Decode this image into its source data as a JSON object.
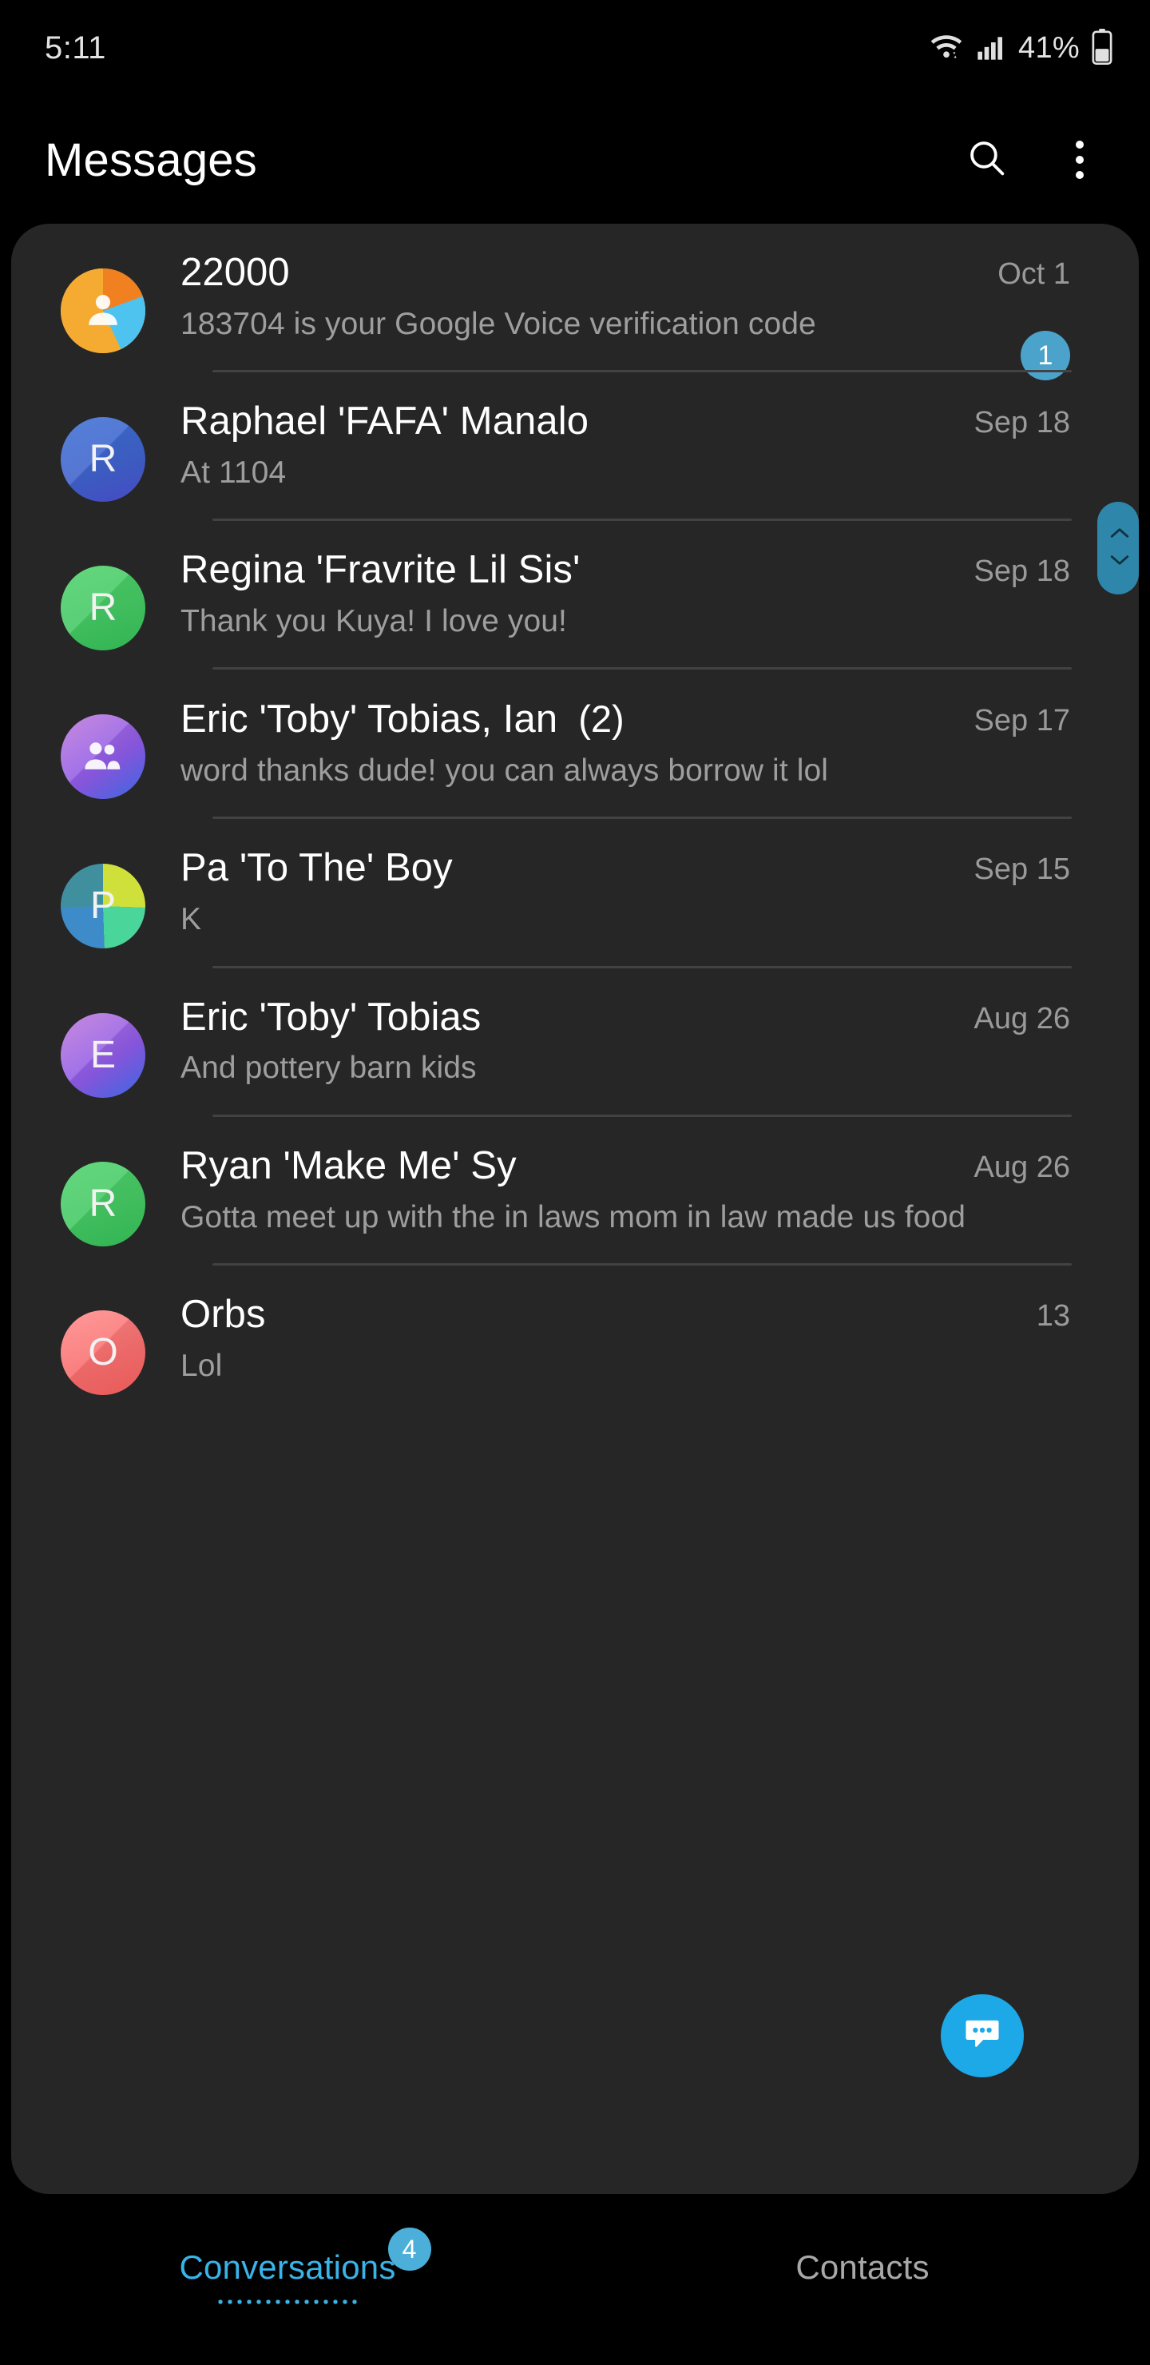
{
  "status_bar": {
    "time": "5:11",
    "battery_percent": "41%",
    "wifi_icon": "wifi-icon",
    "signal_icon": "signal-bars-icon",
    "battery_icon": "battery-icon"
  },
  "app_bar": {
    "title": "Messages",
    "search_icon": "search-icon",
    "overflow_icon": "more-options-icon"
  },
  "conversations": [
    {
      "name": "22000",
      "snippet": "183704 is your Google Voice verification code",
      "date": "Oct 1",
      "unread": "1",
      "count": "",
      "avatar": {
        "type": "person",
        "initial": "",
        "colors": [
          "#f5ab31",
          "#f08020",
          "#4ec3f0"
        ]
      }
    },
    {
      "name": "Raphael 'FAFA' Manalo",
      "snippet": "At 1104",
      "date": "Sep 18",
      "unread": "",
      "count": "",
      "avatar": {
        "type": "initial",
        "initial": "R",
        "colors": [
          "#3b6fd4",
          "#4a4fcf",
          "#3f63cc"
        ]
      }
    },
    {
      "name": "Regina 'Fravrite Lil Sis'",
      "snippet": "Thank you Kuya! I love you!",
      "date": "Sep 18",
      "unread": "",
      "count": "",
      "avatar": {
        "type": "initial",
        "initial": "R",
        "colors": [
          "#4cd16a",
          "#34bf57",
          "#45c964"
        ]
      }
    },
    {
      "name": "Eric 'Toby' Tobias, Ian",
      "snippet": "word thanks dude! you can always borrow it lol",
      "date": "Sep 17",
      "unread": "",
      "count": "(2)",
      "avatar": {
        "type": "group",
        "initial": "",
        "colors": [
          "#c07ad8",
          "#8d5ae8",
          "#3d6ff0"
        ]
      }
    },
    {
      "name": "Pa 'To The' Boy",
      "snippet": "K",
      "date": "Sep 15",
      "unread": "",
      "count": "",
      "avatar": {
        "type": "quad",
        "initial": "P",
        "colors": [
          "#cfe03a",
          "#3e8bc9",
          "#4ad69a",
          "#3f8f9e"
        ]
      }
    },
    {
      "name": "Eric 'Toby' Tobias",
      "snippet": "And pottery barn kids",
      "date": "Aug 26",
      "unread": "",
      "count": "",
      "avatar": {
        "type": "initial",
        "initial": "E",
        "colors": [
          "#c07ad8",
          "#8d5ae8",
          "#3d6ff0"
        ]
      }
    },
    {
      "name": "Ryan 'Make Me' Sy",
      "snippet": "Gotta meet up with the in laws mom in law made us food",
      "date": "Aug 26",
      "unread": "",
      "count": "",
      "avatar": {
        "type": "initial",
        "initial": "R",
        "colors": [
          "#4cd16a",
          "#34bf57",
          "#45c964"
        ]
      }
    },
    {
      "name": "Orbs",
      "snippet": "Lol",
      "date": "13",
      "unread": "",
      "count": "",
      "avatar": {
        "type": "initial",
        "initial": "O",
        "colors": [
          "#ff8b8b",
          "#f8605f",
          "#fa6f6f"
        ]
      }
    }
  ],
  "scrollbar": {
    "up_icon": "chevron-up-icon",
    "down_icon": "chevron-down-icon"
  },
  "fab": {
    "icon": "new-message-icon",
    "label": "Start new conversation"
  },
  "tabs": [
    {
      "label": "Conversations",
      "badge": "4",
      "active": true
    },
    {
      "label": "Contacts",
      "badge": "",
      "active": false
    }
  ],
  "colors": {
    "accent": "#1da9e8",
    "tab_active": "#3ab3e8",
    "badge": "#4ba3cc",
    "scrollbar": "#2e86ab",
    "card_bg": "#262626",
    "page_bg": "#000000",
    "divider": "#424242",
    "text_primary": "#ffffff",
    "text_secondary": "#9e9e9e"
  }
}
